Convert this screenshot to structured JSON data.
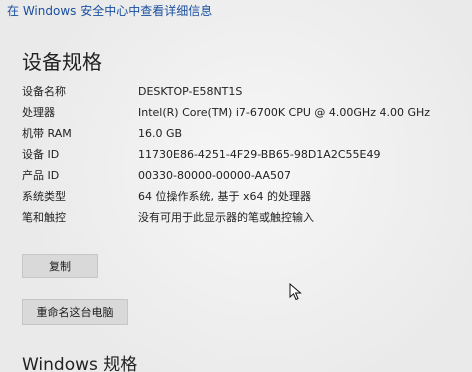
{
  "top_link": "在 Windows 安全中心中查看详细信息",
  "device_specs": {
    "title": "设备规格",
    "rows": [
      {
        "label": "设备名称",
        "value": "DESKTOP-E58NT1S"
      },
      {
        "label": "处理器",
        "value": "Intel(R) Core(TM) i7-6700K CPU @ 4.00GHz   4.00 GHz"
      },
      {
        "label": "机带 RAM",
        "value": "16.0 GB"
      },
      {
        "label": "设备 ID",
        "value": "11730E86-4251-4F29-BB65-98D1A2C55E49"
      },
      {
        "label": "产品 ID",
        "value": "00330-80000-00000-AA507"
      },
      {
        "label": "系统类型",
        "value": "64 位操作系统, 基于 x64 的处理器"
      },
      {
        "label": "笔和触控",
        "value": "没有可用于此显示器的笔或触控输入"
      }
    ],
    "copy_button": "复制",
    "rename_button": "重命名这台电脑"
  },
  "windows_specs": {
    "title": "Windows 规格"
  },
  "icons": {
    "cursor": "mouse-pointer-icon"
  }
}
